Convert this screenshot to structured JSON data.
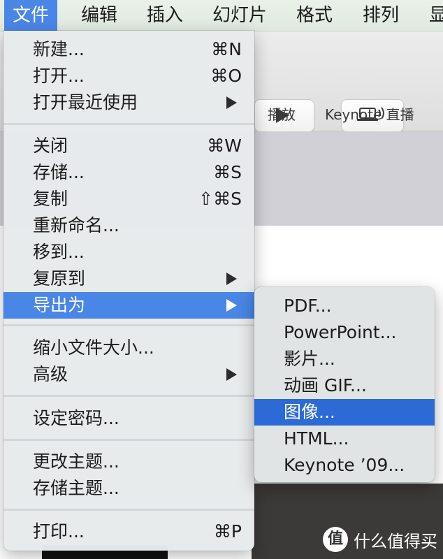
{
  "menubar": {
    "items": [
      "文件",
      "编辑",
      "插入",
      "幻灯片",
      "格式",
      "排列",
      "显"
    ],
    "active_index": 0
  },
  "toolbar": {
    "play_label": "播放",
    "keynote_live_label": "Keynote 直播",
    "play_icon": "play-icon",
    "keynote_live_icon": "laptop-broadcast-icon"
  },
  "file_menu": {
    "items": [
      {
        "label": "新建...",
        "shortcut": "⌘N"
      },
      {
        "label": "打开...",
        "shortcut": "⌘O"
      },
      {
        "label": "打开最近使用",
        "submenu": true
      },
      {
        "label": "关闭",
        "shortcut": "⌘W"
      },
      {
        "label": "存储...",
        "shortcut": "⌘S"
      },
      {
        "label": "复制",
        "shortcut": "⇧⌘S"
      },
      {
        "label": "重新命名..."
      },
      {
        "label": "移到..."
      },
      {
        "label": "复原到",
        "submenu": true
      },
      {
        "label": "导出为",
        "submenu": true,
        "highlighted": true
      },
      {
        "label": "缩小文件大小..."
      },
      {
        "label": "高级",
        "submenu": true
      },
      {
        "label": "设定密码..."
      },
      {
        "label": "更改主题..."
      },
      {
        "label": "存储主题..."
      },
      {
        "label": "打印...",
        "shortcut": "⌘P"
      }
    ]
  },
  "export_submenu": {
    "items": [
      {
        "label": "PDF..."
      },
      {
        "label": "PowerPoint..."
      },
      {
        "label": "影片..."
      },
      {
        "label": "动画 GIF..."
      },
      {
        "label": "图像...",
        "highlighted": true
      },
      {
        "label": "HTML..."
      },
      {
        "label": "Keynote ’09..."
      }
    ]
  },
  "watermark": {
    "logo": "值",
    "text": "什么值得买"
  },
  "colors": {
    "highlight": "#4a86e6",
    "submenu_highlight": "#2c6ad6",
    "menubar_bg": "#e4ede4"
  }
}
